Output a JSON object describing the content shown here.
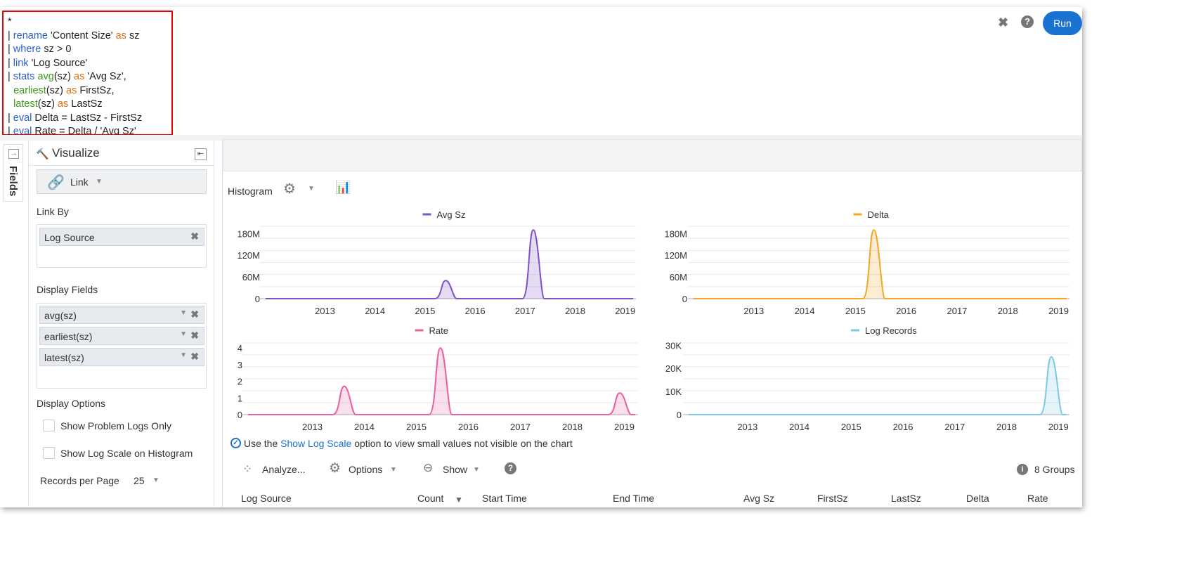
{
  "query": {
    "lines": [
      [
        [
          "*",
          ""
        ]
      ],
      [
        [
          "| ",
          ""
        ],
        [
          "rename",
          "kw"
        ],
        [
          " 'Content Size' ",
          ""
        ],
        [
          "as",
          "as"
        ],
        [
          " sz",
          ""
        ]
      ],
      [
        [
          "| ",
          ""
        ],
        [
          "where",
          "kw"
        ],
        [
          " sz > 0",
          ""
        ]
      ],
      [
        [
          "| ",
          ""
        ],
        [
          "link",
          "kw"
        ],
        [
          " 'Log Source'",
          ""
        ]
      ],
      [
        [
          "| ",
          ""
        ],
        [
          "stats",
          "kw"
        ],
        [
          " ",
          ""
        ],
        [
          "avg",
          "fn"
        ],
        [
          "(sz) ",
          ""
        ],
        [
          "as",
          "as"
        ],
        [
          " 'Avg Sz',",
          ""
        ]
      ],
      [
        [
          "  ",
          ""
        ],
        [
          "earliest",
          "fn"
        ],
        [
          "(sz) ",
          ""
        ],
        [
          "as",
          "as"
        ],
        [
          " FirstSz,",
          ""
        ]
      ],
      [
        [
          "  ",
          ""
        ],
        [
          "latest",
          "fn"
        ],
        [
          "(sz) ",
          ""
        ],
        [
          "as",
          "as"
        ],
        [
          " LastSz",
          ""
        ]
      ],
      [
        [
          "| ",
          ""
        ],
        [
          "eval",
          "kw"
        ],
        [
          " Delta = LastSz - FirstSz",
          ""
        ]
      ],
      [
        [
          "| ",
          ""
        ],
        [
          "eval",
          "kw"
        ],
        [
          " Rate = Delta / 'Avg Sz'",
          ""
        ]
      ]
    ]
  },
  "toolbar": {
    "run_label": "Run",
    "close_icon": "✖",
    "help_icon": "?"
  },
  "fields_tab": "Fields",
  "visualize": {
    "title": "Visualize",
    "type": "Link",
    "link_by_label": "Link By",
    "link_by": [
      "Log Source"
    ],
    "display_fields_label": "Display Fields",
    "display_fields": [
      "avg(sz)",
      "earliest(sz)",
      "latest(sz)"
    ],
    "display_options_label": "Display Options",
    "show_problem_logs": "Show Problem Logs Only",
    "show_problem_logs_checked": false,
    "show_log_scale": "Show Log Scale on Histogram",
    "show_log_scale_checked": false,
    "records_per_page_label": "Records per Page",
    "records_per_page": "25"
  },
  "histogram": {
    "label": "Histogram",
    "hint_pre": "Use the ",
    "hint_link": "Show Log Scale",
    "hint_post": " option to view small values not visible on the chart"
  },
  "chart_data": [
    {
      "type": "area",
      "series": [
        {
          "name": "Avg Sz",
          "color": "#7b52c8",
          "peaks": [
            {
              "x": 2015.9,
              "y": 50000000
            },
            {
              "x": 2017.65,
              "y": 190000000
            }
          ]
        }
      ],
      "xlim": [
        2012.3,
        2019.7
      ],
      "xticks": [
        "2013",
        "2014",
        "2015",
        "2016",
        "2017",
        "2018",
        "2019"
      ],
      "ylim": [
        0,
        200000000
      ],
      "yticks": [
        {
          "v": 0,
          "l": "0"
        },
        {
          "v": 60000000,
          "l": "60M"
        },
        {
          "v": 120000000,
          "l": "120M"
        },
        {
          "v": 180000000,
          "l": "180M"
        }
      ],
      "legend": "top"
    },
    {
      "type": "area",
      "series": [
        {
          "name": "Delta",
          "color": "#f5a623",
          "peaks": [
            {
              "x": 2015.85,
              "y": 190000000
            }
          ]
        }
      ],
      "xlim": [
        2012.3,
        2019.7
      ],
      "xticks": [
        "2013",
        "2014",
        "2015",
        "2016",
        "2017",
        "2018",
        "2019"
      ],
      "ylim": [
        0,
        200000000
      ],
      "yticks": [
        {
          "v": 0,
          "l": "0"
        },
        {
          "v": 60000000,
          "l": "60M"
        },
        {
          "v": 120000000,
          "l": "120M"
        },
        {
          "v": 180000000,
          "l": "180M"
        }
      ],
      "legend": "top"
    },
    {
      "type": "area",
      "series": [
        {
          "name": "Rate",
          "color": "#e8609e",
          "peaks": [
            {
              "x": 2014.1,
              "y": 1.7
            },
            {
              "x": 2015.95,
              "y": 4.0
            },
            {
              "x": 2019.4,
              "y": 1.3
            }
          ]
        }
      ],
      "xlim": [
        2012.25,
        2019.75
      ],
      "xticks": [
        "2013",
        "2014",
        "2015",
        "2016",
        "2017",
        "2018",
        "2019"
      ],
      "ylim": [
        0,
        4.3
      ],
      "yticks": [
        {
          "v": 0,
          "l": "0"
        },
        {
          "v": 1,
          "l": "1"
        },
        {
          "v": 2,
          "l": "2"
        },
        {
          "v": 3,
          "l": "3"
        },
        {
          "v": 4,
          "l": "4"
        }
      ],
      "legend": "top"
    },
    {
      "type": "area",
      "series": [
        {
          "name": "Log Records",
          "color": "#7ec8e3",
          "peaks": [
            {
              "x": 2019.35,
              "y": 25000
            }
          ]
        }
      ],
      "xlim": [
        2012.35,
        2019.7
      ],
      "xticks": [
        "2013",
        "2014",
        "2015",
        "2016",
        "2017",
        "2018",
        "2019"
      ],
      "ylim": [
        0,
        31000
      ],
      "yticks": [
        {
          "v": 0,
          "l": "0"
        },
        {
          "v": 10000,
          "l": "10K"
        },
        {
          "v": 20000,
          "l": "20K"
        },
        {
          "v": 30000,
          "l": "30K"
        }
      ],
      "legend": "top"
    }
  ],
  "table_toolbar": {
    "analyze": "Analyze...",
    "options": "Options",
    "show": "Show",
    "groups": "8 Groups"
  },
  "table": {
    "columns": [
      "Log Source",
      "Count",
      "Start Time",
      "End Time",
      "Avg Sz",
      "FirstSz",
      "LastSz",
      "Delta",
      "Rate"
    ]
  }
}
